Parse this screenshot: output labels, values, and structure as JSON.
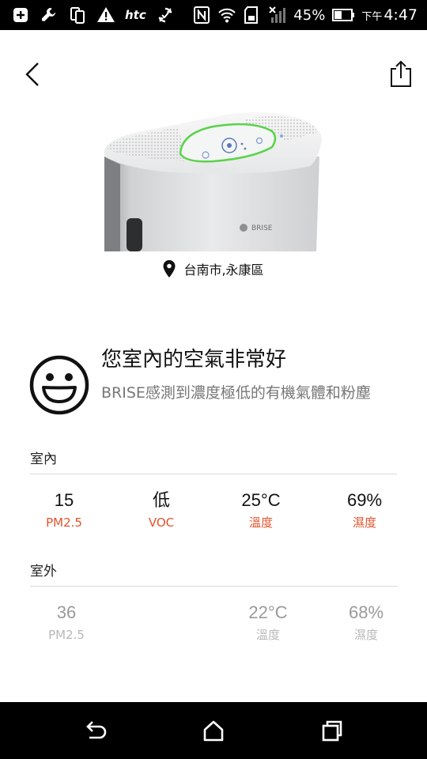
{
  "status_bar": {
    "carrier": "htc",
    "battery_percent": "45%",
    "time_prefix": "下午",
    "time": "4:47",
    "icons": [
      "add-box-icon",
      "wrench-icon",
      "copy-icon",
      "warning-icon",
      "htc-logo",
      "sync-icon",
      "nfc-icon",
      "wifi-icon",
      "sd-card-icon",
      "signal-off-icon",
      "battery-icon"
    ]
  },
  "header": {
    "back_icon": "chevron-left-icon",
    "share_icon": "share-icon"
  },
  "device": {
    "brand": "BRISE",
    "accent_color": "#5ad34a"
  },
  "location": {
    "icon": "location-pin-icon",
    "text": "台南市,永康區"
  },
  "air_quality": {
    "icon": "smiley-icon",
    "headline": "您室內的空氣非常好",
    "description": "BRISE感測到濃度極低的有機氣體和粉塵"
  },
  "indoor": {
    "title": "室內",
    "metrics": [
      {
        "value": "15",
        "label": "PM2.5"
      },
      {
        "value": "低",
        "label": "VOC"
      },
      {
        "value": "25°C",
        "label": "溫度"
      },
      {
        "value": "69%",
        "label": "濕度"
      }
    ],
    "label_color": "#e2522a"
  },
  "outdoor": {
    "title": "室外",
    "metrics": [
      {
        "value": "36",
        "label": "PM2.5"
      },
      {
        "value": "22°C",
        "label": "溫度"
      },
      {
        "value": "68%",
        "label": "濕度"
      }
    ]
  },
  "nav_bar": {
    "icons": [
      "back-arrow-icon",
      "home-icon",
      "recent-apps-icon"
    ]
  }
}
